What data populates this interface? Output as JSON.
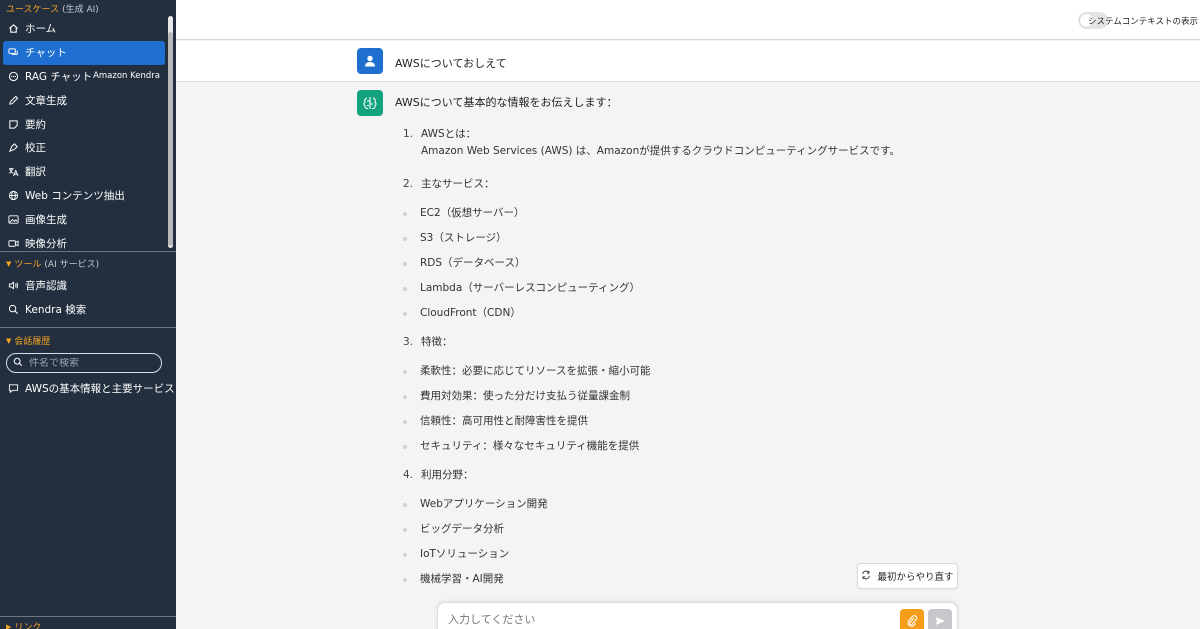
{
  "sidebar": {
    "usecase_title": "ユースケース",
    "usecase_paren": "(生成 AI)",
    "items": [
      {
        "label": "ホーム",
        "icon": "home-icon"
      },
      {
        "label": "チャット",
        "icon": "chat-icon"
      },
      {
        "label": "RAG チャット",
        "icon": "rag-chat-icon",
        "sub": "Amazon Kendra"
      },
      {
        "label": "文章生成",
        "icon": "pencil-icon"
      },
      {
        "label": "要約",
        "icon": "note-icon"
      },
      {
        "label": "校正",
        "icon": "pen-icon"
      },
      {
        "label": "翻訳",
        "icon": "translate-icon"
      },
      {
        "label": "Web コンテンツ抽出",
        "icon": "globe-icon"
      },
      {
        "label": "画像生成",
        "icon": "image-icon"
      },
      {
        "label": "映像分析",
        "icon": "video-icon"
      }
    ],
    "tools_title": "ツール",
    "tools_paren": "(AI サービス)",
    "tools": [
      {
        "label": "音声認識",
        "icon": "speaker-icon"
      },
      {
        "label": "Kendra 検索",
        "icon": "search-icon"
      }
    ],
    "history_title": "会話履歴",
    "search_placeholder": "件名で検索",
    "history": [
      {
        "label": "AWSの基本情報と主要サービス",
        "icon": "chat-bubble-icon"
      }
    ],
    "link_title": "リンク"
  },
  "topbar": {
    "toggle_label": "システムコンテキストの表示",
    "toggle_on": false
  },
  "chat": {
    "user_message": "AWSについておしえて",
    "assistant_intro": "AWSについて基本的な情報をお伝えします：",
    "sections": [
      {
        "num": "1.",
        "title": "AWSとは：",
        "body": "Amazon Web Services (AWS) は、Amazonが提供するクラウドコンピューティングサービスです。"
      },
      {
        "num": "2.",
        "title": "主なサービス：",
        "bullets": [
          "EC2（仮想サーバー）",
          "S3（ストレージ）",
          "RDS（データベース）",
          "Lambda（サーバーレスコンピューティング）",
          "CloudFront（CDN）"
        ]
      },
      {
        "num": "3.",
        "title": "特徴：",
        "bullets": [
          "柔軟性：必要に応じてリソースを拡張・縮小可能",
          "費用対効果：使った分だけ支払う従量課金制",
          "信頼性：高可用性と耐障害性を提供",
          "セキュリティ：様々なセキュリティ機能を提供"
        ]
      },
      {
        "num": "4.",
        "title": "利用分野：",
        "bullets": [
          "Webアプリケーション開発",
          "ビッグデータ分析",
          "IoTソリューション",
          "機械学習・AI開発"
        ]
      }
    ],
    "retry_label": "最初からやり直す",
    "input_placeholder": "入力してください"
  },
  "colors": {
    "sidebar_bg": "#232f3e",
    "active_item": "#1f6fd1",
    "section_title": "#f5a623",
    "user_avatar": "#1f6fd1",
    "bot_avatar": "#12a37e",
    "attach_button": "#f59c1a",
    "send_button": "#c6c8cc"
  }
}
